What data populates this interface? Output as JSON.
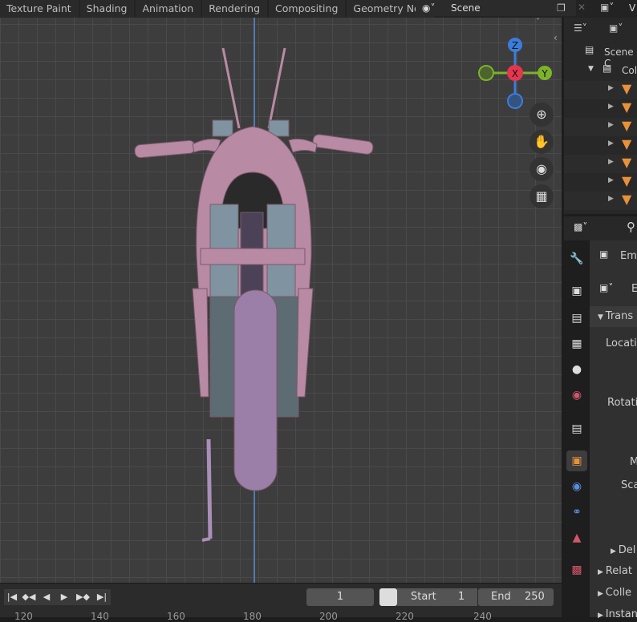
{
  "topbar": {
    "tabs": [
      "Texture Paint",
      "Shading",
      "Animation",
      "Rendering",
      "Compositing",
      "Geometry Nod"
    ],
    "scene": "Scene",
    "view_layer_initial": "V"
  },
  "gizmo": {
    "x": "X",
    "y": "Y",
    "z": "Z",
    "colors": {
      "x": "#e8354f",
      "y": "#7cb32a",
      "z": "#3b7ddb"
    }
  },
  "nav": [
    "zoom-in-icon",
    "hand-pan-icon",
    "camera-icon",
    "grid-icon"
  ],
  "timeline": {
    "current_frame": "1",
    "start_label": "Start",
    "start": "1",
    "end_label": "End",
    "end": "250",
    "ticks": [
      "120",
      "140",
      "160",
      "180",
      "200",
      "220",
      "240"
    ]
  },
  "outliner": {
    "scene_collection": "Scene C",
    "collection": "Col",
    "object_count": 7
  },
  "properties": {
    "object_name": "Emp",
    "data_name": "E",
    "transform": "Trans",
    "location": "Locatio",
    "rotation": "Rotatio",
    "mode": "M",
    "scale": "Sca",
    "delta": "Del",
    "relations": "Relat",
    "collections": "Colle",
    "instancing": "Instan"
  },
  "colors": {
    "accent": "#e8913a",
    "model": "#b98aa4"
  }
}
